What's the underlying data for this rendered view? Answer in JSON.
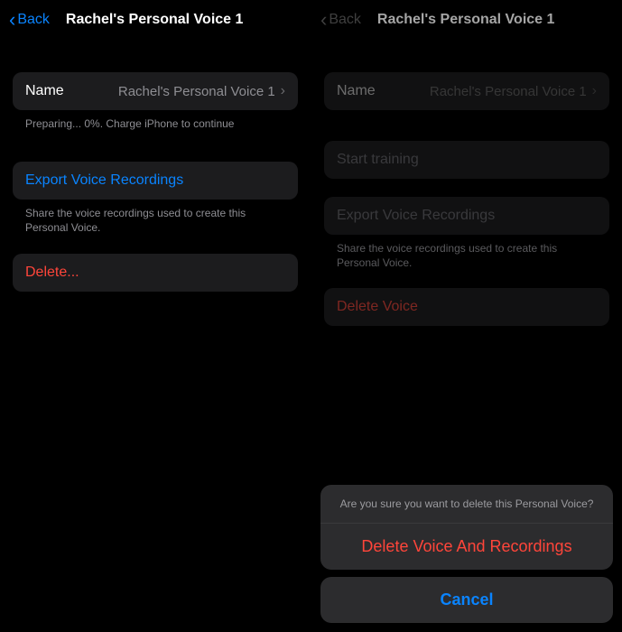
{
  "left": {
    "back": "Back",
    "title": "Rachel's Personal Voice 1",
    "name_row": {
      "label": "Name",
      "value": "Rachel's Personal Voice 1"
    },
    "status_footer": "Preparing... 0%. Charge iPhone to continue",
    "export": {
      "label": "Export Voice Recordings"
    },
    "export_footer": "Share the voice recordings used to create this Personal Voice.",
    "delete": {
      "label": "Delete..."
    }
  },
  "right": {
    "back": "Back",
    "title": "Rachel's Personal Voice 1",
    "name_row": {
      "label": "Name",
      "value": "Rachel's Personal Voice 1"
    },
    "start_training": {
      "label": "Start training"
    },
    "export": {
      "label": "Export Voice Recordings"
    },
    "export_footer": "Share the voice recordings used to create this Personal Voice.",
    "delete": {
      "label": "Delete Voice"
    },
    "sheet": {
      "message": "Are you sure you want to delete this Personal Voice?",
      "confirm": "Delete Voice And Recordings",
      "cancel": "Cancel"
    }
  }
}
